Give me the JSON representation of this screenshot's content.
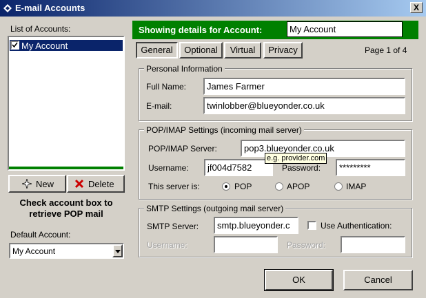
{
  "window": {
    "title": "E-mail Accounts",
    "close_glyph": "X"
  },
  "left": {
    "list_label": "List of Accounts:",
    "accounts": [
      {
        "name": "My Account",
        "checked": true,
        "selected": true
      }
    ],
    "new_label": "New",
    "delete_label": "Delete",
    "check_hint_line1": "Check account box to",
    "check_hint_line2": "retrieve POP mail",
    "default_label": "Default Account:",
    "default_value": "My Account"
  },
  "header": {
    "showing_label": "Showing details for Account:",
    "account_name": "My Account",
    "accent_color": "#008000"
  },
  "tabs": [
    {
      "label": "General",
      "active": true
    },
    {
      "label": "Optional",
      "active": false
    },
    {
      "label": "Virtual",
      "active": false
    },
    {
      "label": "Privacy",
      "active": false
    }
  ],
  "page_indicator": "Page 1 of 4",
  "personal": {
    "title": "Personal Information",
    "full_name_label": "Full Name:",
    "full_name_value": "James Farmer",
    "email_label": "E-mail:",
    "email_value": "twinlobber@blueyonder.co.uk"
  },
  "popimap": {
    "title": "POP/IMAP Settings (incoming mail server)",
    "server_label": "POP/IMAP Server:",
    "server_value": "pop3.blueyonder.co.uk",
    "tooltip": "e.g. provider.com",
    "username_label": "Username:",
    "username_value": "jf004d7582",
    "password_label": "Password:",
    "password_value": "*********",
    "server_is_label": "This server is:",
    "options": [
      {
        "label": "POP",
        "selected": true
      },
      {
        "label": "APOP",
        "selected": false
      },
      {
        "label": "IMAP",
        "selected": false
      }
    ]
  },
  "smtp": {
    "title": "SMTP Settings (outgoing mail server)",
    "server_label": "SMTP Server:",
    "server_value": "smtp.blueyonder.c",
    "use_auth_label": "Use Authentication:",
    "use_auth_checked": false,
    "username_label": "Username:",
    "username_value": "",
    "password_label": "Password:",
    "password_value": ""
  },
  "buttons": {
    "ok_label": "OK",
    "cancel_label": "Cancel"
  }
}
